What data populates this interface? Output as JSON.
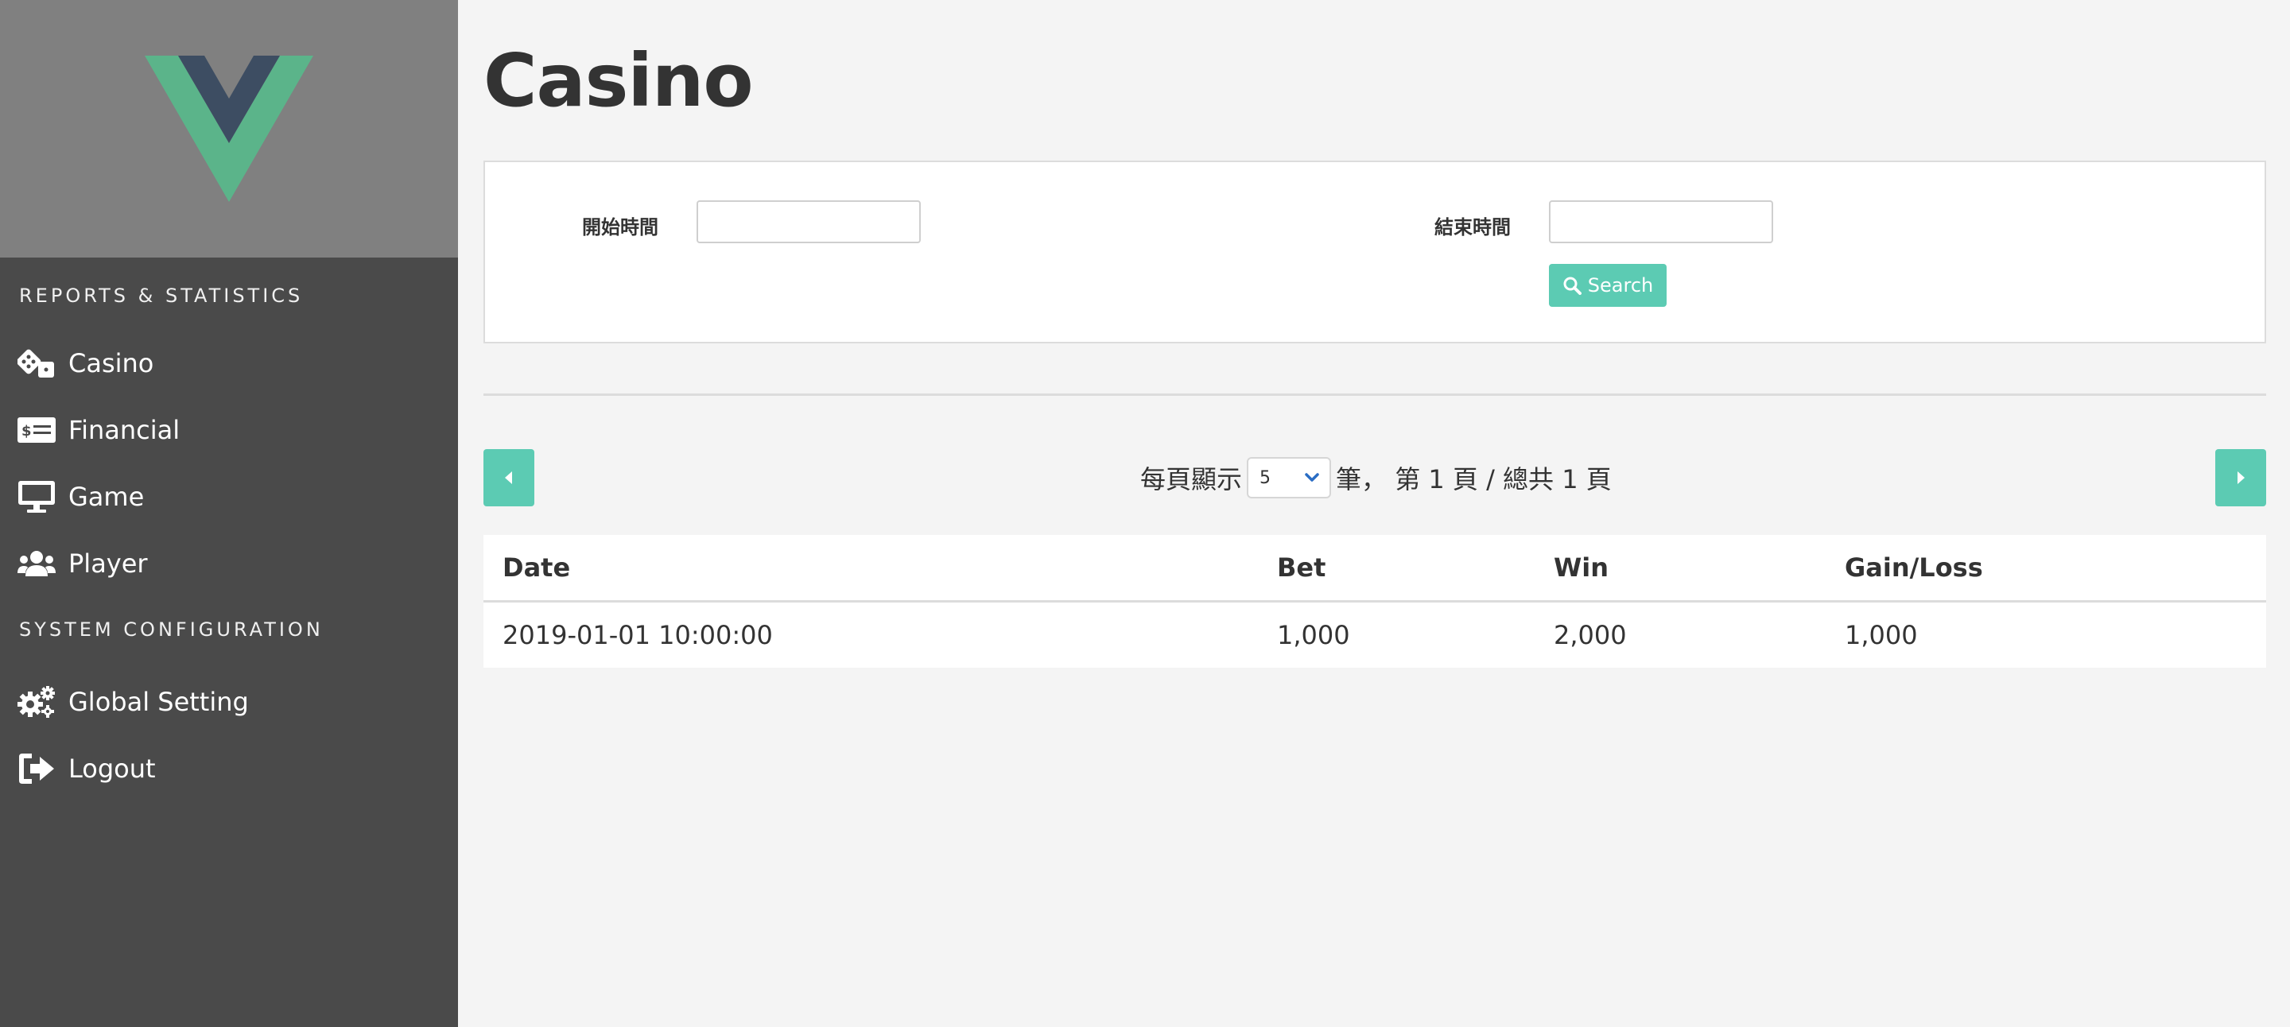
{
  "sidebar": {
    "sections": [
      {
        "title": "REPORTS & STATISTICS"
      },
      {
        "title": "SYSTEM CONFIGURATION"
      }
    ],
    "items": [
      {
        "label": "Casino",
        "icon": "dice-icon"
      },
      {
        "label": "Financial",
        "icon": "money-check-icon"
      },
      {
        "label": "Game",
        "icon": "desktop-icon"
      },
      {
        "label": "Player",
        "icon": "users-icon"
      },
      {
        "label": "Global Setting",
        "icon": "cogs-icon"
      },
      {
        "label": "Logout",
        "icon": "sign-out-icon"
      }
    ]
  },
  "page": {
    "title": "Casino"
  },
  "search": {
    "start_label": "開始時間",
    "start_value": "",
    "end_label": "結束時間",
    "end_value": "",
    "button_label": "Search"
  },
  "pager": {
    "prefix": "每頁顯示",
    "page_size": "5",
    "suffix": "筆， 第 1 頁 / 總共 1 頁"
  },
  "table": {
    "headers": [
      "Date",
      "Bet",
      "Win",
      "Gain/Loss"
    ],
    "rows": [
      [
        "2019-01-01 10:00:00",
        "1,000",
        "2,000",
        "1,000"
      ]
    ]
  },
  "colors": {
    "accent": "#5ccbb3",
    "sidebar_bg": "#4a4a4a",
    "logo_bg": "#808080",
    "vue_green": "#41b883",
    "vue_dark": "#35495e"
  }
}
